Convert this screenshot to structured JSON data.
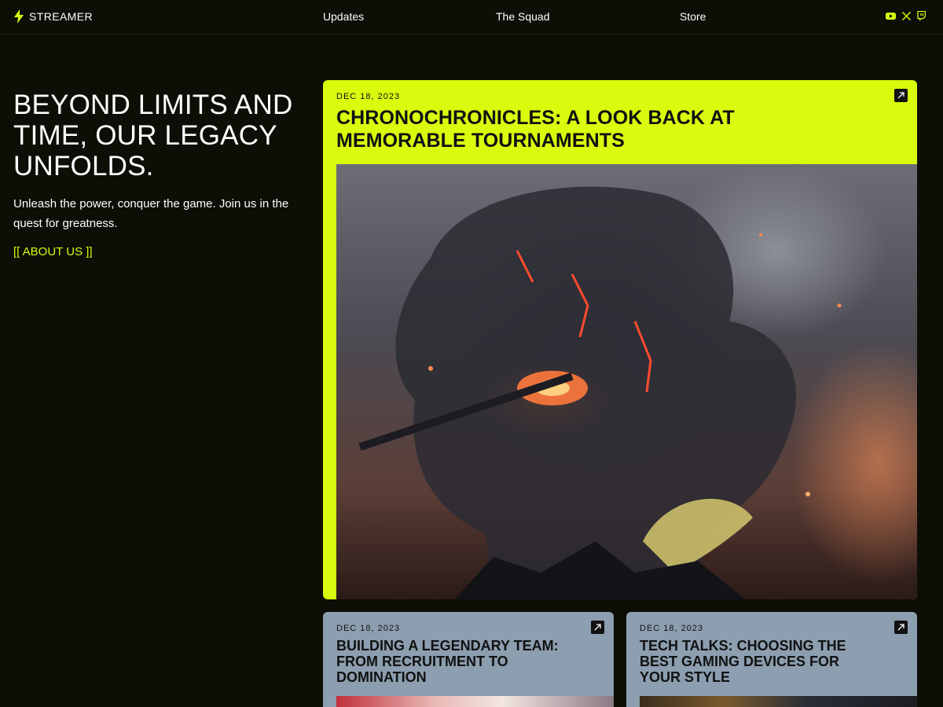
{
  "brand": {
    "name": "STREAMER",
    "accent": "#d8fb12"
  },
  "nav": {
    "links": [
      "Updates",
      "The Squad",
      "Store"
    ],
    "socials": [
      "youtube-icon",
      "x-icon",
      "twitch-icon"
    ]
  },
  "hero": {
    "title": "BEYOND LIMITS AND TIME, OUR LEGACY UNFOLDS.",
    "subtitle": "Unleash the power, conquer the game. Join us in the quest for greatness.",
    "about_link": "[[ ABOUT US ]]"
  },
  "featured": {
    "date": "DEC 18, 2023",
    "title": "CHRONOCHRONICLES: A LOOK BACK AT MEMORABLE TOURNAMENTS",
    "background": "#d8fb0e"
  },
  "cards": [
    {
      "date": "DEC 18, 2023",
      "title": "BUILDING A LEGENDARY TEAM: FROM RECRUITMENT TO DOMINATION"
    },
    {
      "date": "DEC 18, 2023",
      "title": "TECH TALKS: CHOOSING THE BEST GAMING DEVICES FOR YOUR STYLE"
    }
  ],
  "card_background": "#8c9eaf"
}
